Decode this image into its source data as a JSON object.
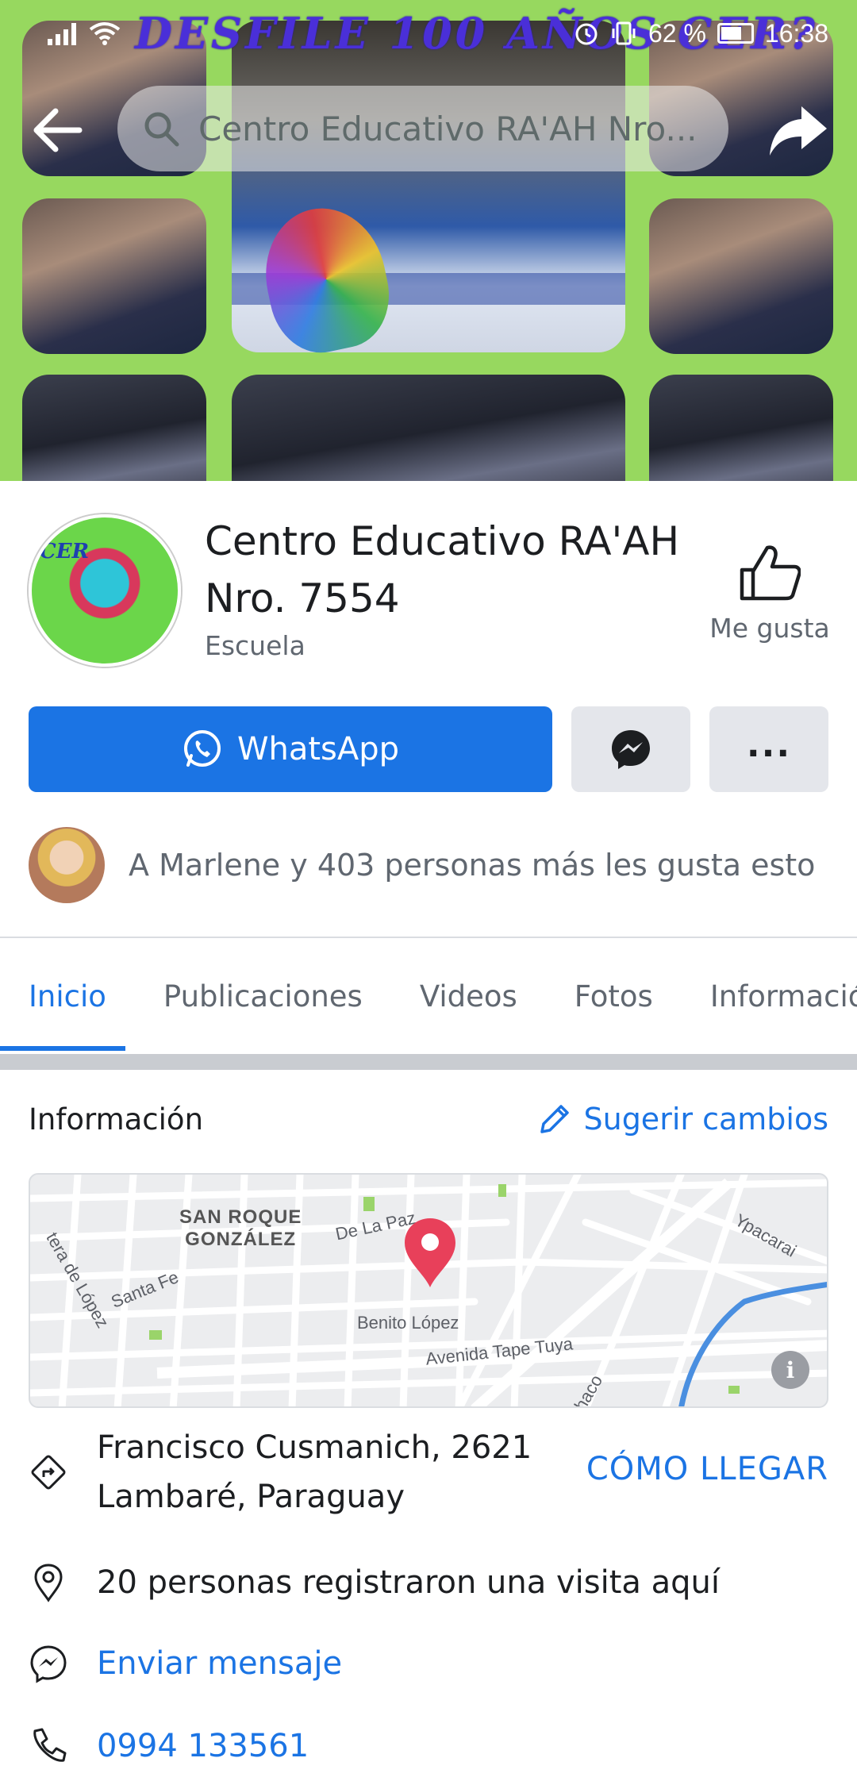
{
  "status_bar": {
    "battery": "62 %",
    "time": "16:38"
  },
  "cover": {
    "title": "DESFILE 100 AÑOS CER?"
  },
  "top_nav": {
    "search_text": "Centro Educativo RA'AH Nro..."
  },
  "page": {
    "name": "Centro Educativo RA'AH Nro. 7554",
    "category": "Escuela",
    "avatar_tag": "CER",
    "like_label": "Me gusta"
  },
  "actions": {
    "whatsapp_label": "WhatsApp",
    "more_label": "..."
  },
  "likers": {
    "text": "A Marlene y 403 personas más les gusta esto"
  },
  "tabs": [
    {
      "label": "Inicio",
      "active": true
    },
    {
      "label": "Publicaciones",
      "active": false
    },
    {
      "label": "Videos",
      "active": false
    },
    {
      "label": "Fotos",
      "active": false
    },
    {
      "label": "Información",
      "active": false
    }
  ],
  "info": {
    "title": "Información",
    "suggest_label": "Sugerir cambios",
    "map_labels": {
      "neighborhood": "SAN ROQUE\nGONZÁLEZ",
      "street1": "De La Paz",
      "street2": "Ypacarai",
      "street3": "Santa Fe",
      "street4": "Benito López",
      "street5": "Avenida Tape Tuya",
      "street6": "tera de López",
      "street7": "haco",
      "info_glyph": "i"
    },
    "address_line1": "Francisco Cusmanich, 2621",
    "address_line2": "Lambaré, Paraguay",
    "directions_label": "CÓMO LLEGAR",
    "visits_text": "20 personas registraron una visita aquí",
    "message_label": "Enviar mensaje",
    "phone": "0994 133561"
  },
  "colors": {
    "accent": "#1b74e4",
    "cover_bg": "#97d85f",
    "secondary_text": "#606770"
  }
}
